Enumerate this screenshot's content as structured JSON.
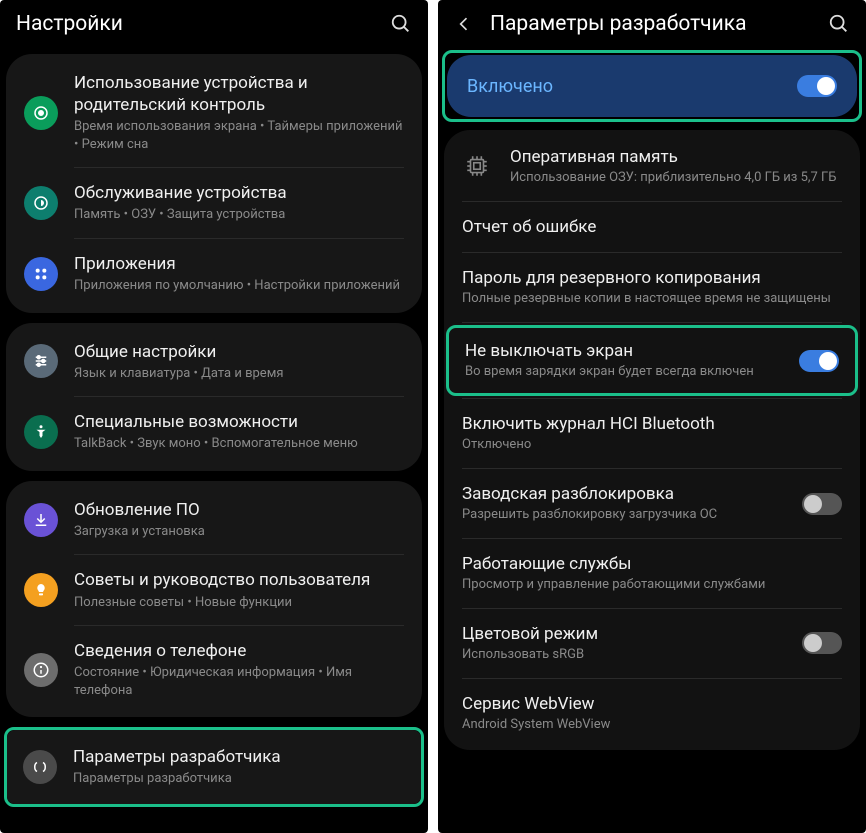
{
  "left": {
    "header": {
      "title": "Настройки"
    },
    "groups": [
      [
        {
          "title": "Использование устройства и родительский контроль",
          "sub": "Время использования экрана  •  Таймеры приложений  •  Режим сна"
        },
        {
          "title": "Обслуживание устройства",
          "sub": "Память  •  ОЗУ  •  Защита устройства"
        },
        {
          "title": "Приложения",
          "sub": "Приложения по умолчанию  •  Настройки приложений"
        }
      ],
      [
        {
          "title": "Общие настройки",
          "sub": "Язык и клавиатура  •  Дата и время"
        },
        {
          "title": "Специальные возможности",
          "sub": "TalkBack  •  Звук моно  •  Вспомогательное меню"
        }
      ],
      [
        {
          "title": "Обновление ПО",
          "sub": "Загрузка и установка"
        },
        {
          "title": "Советы и руководство пользователя",
          "sub": "Полезные советы  •  Новые функции"
        },
        {
          "title": "Сведения о телефоне",
          "sub": "Состояние  •  Юридическая информация  •  Имя телефона"
        }
      ]
    ],
    "dev": {
      "title": "Параметры разработчика",
      "sub": "Параметры разработчика"
    }
  },
  "right": {
    "header": {
      "title": "Параметры разработчика"
    },
    "enabled_label": "Включено",
    "items": {
      "memory": {
        "title": "Оперативная память",
        "sub": "Использование ОЗУ: приблизительно 4,0 ГБ из 5,7 ГБ"
      },
      "bugreport": {
        "title": "Отчет об ошибке"
      },
      "backup_pw": {
        "title": "Пароль для резервного копирования",
        "sub": "Полные резервные копии в настоящее время не защищены"
      },
      "stay_awake": {
        "title": "Не выключать экран",
        "sub": "Во время зарядки экран будет всегда включен"
      },
      "hci": {
        "title": "Включить журнал HCI Bluetooth",
        "sub": "Отключено"
      },
      "oem": {
        "title": "Заводская разблокировка",
        "sub": "Разрешить разблокировку загрузчика ОС"
      },
      "services": {
        "title": "Работающие службы",
        "sub": "Просмотр и управление работающими службами"
      },
      "color": {
        "title": "Цветовой режим",
        "sub": "Использовать sRGB"
      },
      "webview": {
        "title": "Сервис WebView",
        "sub": "Android System WebView"
      }
    }
  }
}
